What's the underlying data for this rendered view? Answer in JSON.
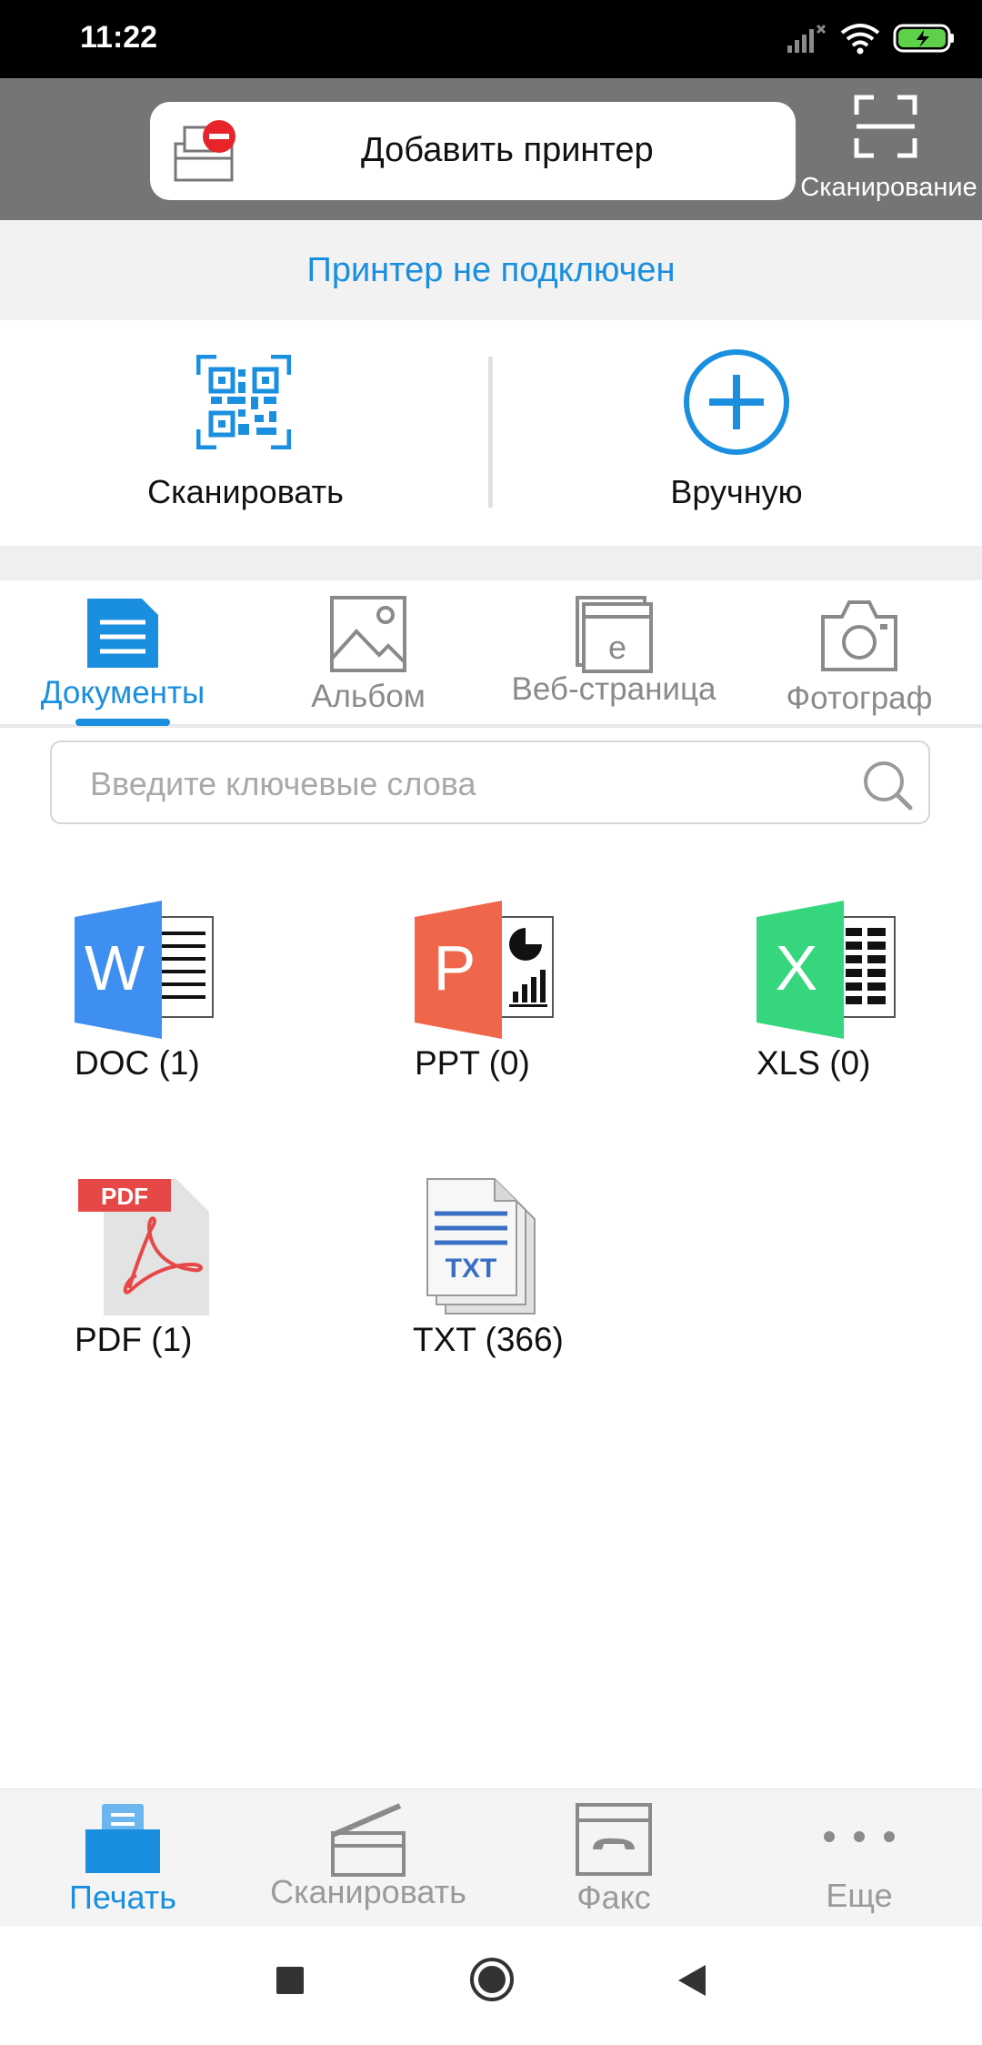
{
  "status_bar": {
    "time": "11:22"
  },
  "top_bar": {
    "add_printer_label": "Добавить принтер",
    "scan_label": "Сканирование"
  },
  "connection": {
    "status_text": "Принтер не подключен"
  },
  "actions": {
    "scan_label": "Сканировать",
    "manual_label": "Вручную"
  },
  "tabs": [
    {
      "label": "Документы",
      "icon": "document-icon",
      "active": true
    },
    {
      "label": "Альбом",
      "icon": "image-icon",
      "active": false
    },
    {
      "label": "Веб-страница",
      "icon": "webpage-icon",
      "active": false
    },
    {
      "label": "Фотограф",
      "icon": "camera-icon",
      "active": false
    }
  ],
  "search": {
    "placeholder": "Введите ключевые слова",
    "value": ""
  },
  "files": [
    {
      "label": "DOC (1)",
      "icon": "word-icon"
    },
    {
      "label": "PPT (0)",
      "icon": "powerpoint-icon"
    },
    {
      "label": "XLS (0)",
      "icon": "excel-icon"
    },
    {
      "label": "PDF (1)",
      "icon": "pdf-icon",
      "badge": "PDF"
    },
    {
      "label": "TXT (366)",
      "icon": "txt-icon",
      "badge": "TXT"
    }
  ],
  "bottom_nav": [
    {
      "label": "Печать",
      "icon": "print-icon",
      "active": true
    },
    {
      "label": "Сканировать",
      "icon": "scanner-icon",
      "active": false
    },
    {
      "label": "Факс",
      "icon": "fax-icon",
      "active": false
    },
    {
      "label": "Еще",
      "icon": "more-icon",
      "active": false
    }
  ],
  "colors": {
    "accent": "#1a8fe0",
    "topbar": "#757575",
    "word": "#3f8ff0",
    "ppt": "#f0664a",
    "xls": "#36d67e",
    "pdf_red": "#e64848"
  }
}
